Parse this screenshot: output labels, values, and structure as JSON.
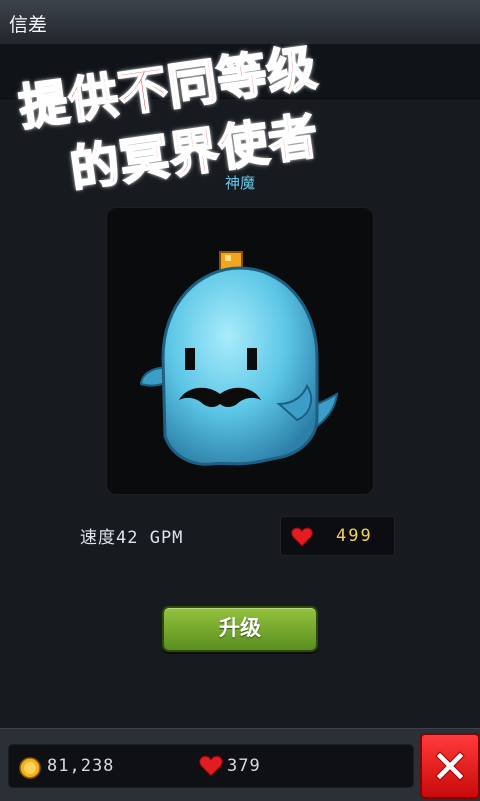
{
  "window": {
    "title": "信差"
  },
  "promo": {
    "line1": "提供不同等级",
    "line2": "的冥界使者"
  },
  "pet": {
    "name": "神魔",
    "image_icon": "ghost-with-mustache-icon"
  },
  "stats": {
    "speed_text": "速度42 GPM",
    "hearts_value": "499",
    "heart_icon": "heart-icon"
  },
  "actions": {
    "upgrade_label": "升级",
    "close_icon": "close-x-icon"
  },
  "resources": {
    "coins": "81,238",
    "coin_icon": "coin-icon",
    "lives": "379",
    "life_icon": "heart-icon"
  },
  "colors": {
    "accent_green": "#7aac2e",
    "close_red": "#e11d1d",
    "promo_red": "#d7141b",
    "ghost_cyan": "#5cc6e6"
  }
}
